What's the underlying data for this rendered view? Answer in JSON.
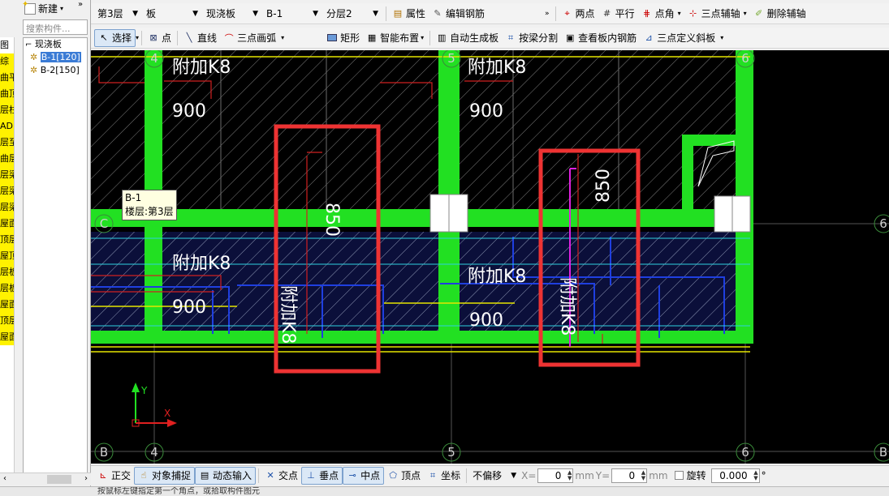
{
  "left": {
    "new_label": "新建",
    "search_placeholder": "搜索构件...",
    "tree_root": "现浇板",
    "tree_items": [
      "B-1[120]",
      "B-2[150]"
    ],
    "strip_items": [
      "图",
      "综",
      "曲平",
      "曲顶",
      "层柱",
      "ADI",
      "层至",
      "曲层",
      "层梁",
      "层梁",
      "层梁",
      "屋面",
      "顶层",
      "屋顶",
      "层板",
      "层板",
      "屋面",
      "顶层",
      "屋面"
    ]
  },
  "toolbar1": {
    "floor": "第3层",
    "category": "板",
    "type": "现浇板",
    "component": "B-1",
    "layer": "分层2",
    "attr_label": "属性",
    "edit_rebar_label": "编辑钢筋",
    "two_point_label": "两点",
    "parallel_label": "平行",
    "point_angle_label": "点角",
    "three_point_axis_label": "三点辅轴",
    "delete_axis_label": "删除辅轴"
  },
  "toolbar2": {
    "select_label": "选择",
    "point_label": "点",
    "line_label": "直线",
    "arc_label": "三点画弧",
    "rect_label": "矩形",
    "smart_place_label": "智能布置",
    "auto_slab_label": "自动生成板",
    "split_by_beam_label": "按梁分割",
    "view_rebar_label": "查看板内钢筋",
    "slope_label": "三点定义斜板"
  },
  "canvas": {
    "tooltip_name": "B-1",
    "tooltip_floor": "楼层:第3层",
    "axis_labels": [
      "4",
      "5",
      "6",
      "B",
      "C",
      "6",
      "B",
      "C"
    ],
    "annotations": [
      "附加K8",
      "900",
      "附加K8",
      "900",
      "850",
      "850",
      "附加K8",
      "900",
      "附加K8",
      "900",
      "附加K8",
      "附加K8"
    ]
  },
  "bottombar": {
    "ortho_label": "正交",
    "snap_label": "对象捕捉",
    "dynamic_label": "动态输入",
    "intersect_label": "交点",
    "perp_label": "垂点",
    "mid_label": "中点",
    "vertex_label": "顶点",
    "coord_label": "坐标",
    "offset_value": "不偏移",
    "x_label": "X=",
    "x_value": "0",
    "mm1": "mm",
    "y_label": "Y=",
    "y_value": "0",
    "mm2": "mm",
    "rotate_label": "旋转",
    "rotate_value": "0.000",
    "degree": "°"
  },
  "status": {
    "text": "按鼠标左键指定第一个角点，或拾取构件图元"
  }
}
